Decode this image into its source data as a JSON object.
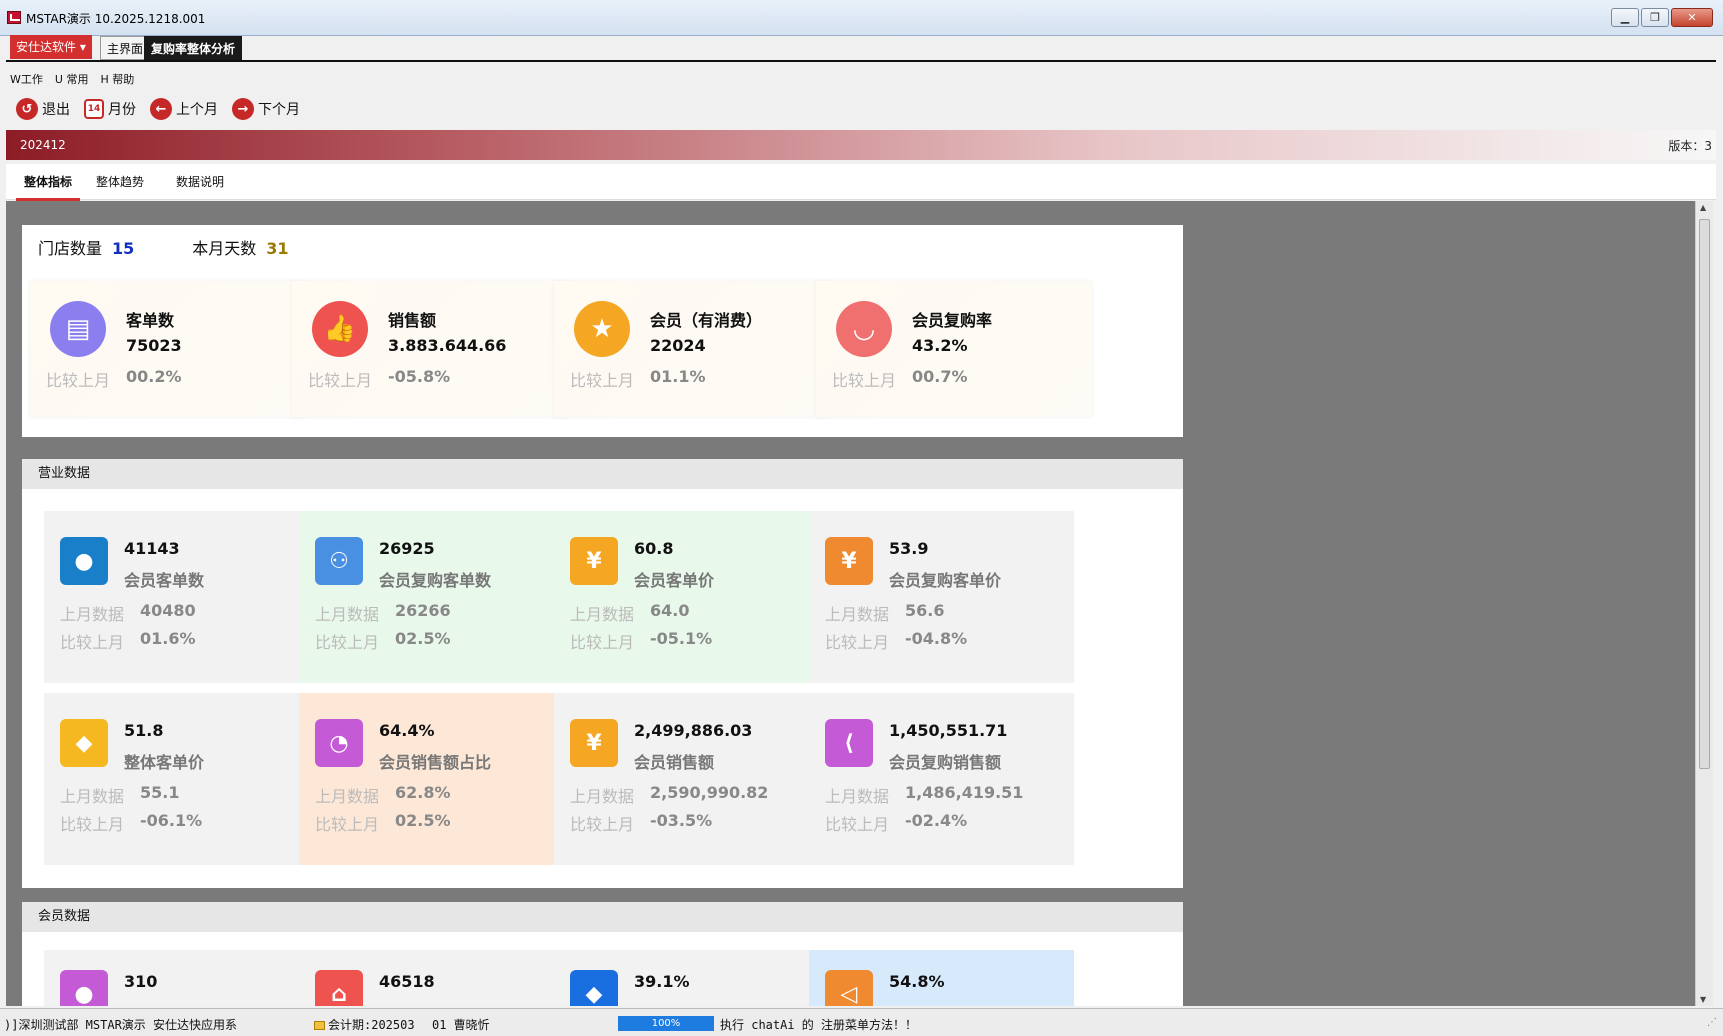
{
  "window": {
    "title": "MSTAR演示   10.2025.1218.001"
  },
  "tabs": {
    "brand": "安仕达软件",
    "main": "主界面",
    "active": "复购率整体分析"
  },
  "menu": [
    "W工作",
    "U 常用",
    "H 帮助"
  ],
  "toolbar": {
    "exit": "退出",
    "month": "月份",
    "calendar_day": "14",
    "prev": "上个月",
    "next": "下个月"
  },
  "banner": {
    "period": "202412",
    "version": "版本：3"
  },
  "subtabs": [
    "整体指标",
    "整体趋势",
    "数据说明"
  ],
  "summary": {
    "store_label": "门店数量",
    "store_count": "15",
    "days_label": "本月天数",
    "days_count": "31"
  },
  "kpis": [
    {
      "title": "客单数",
      "value": "75023",
      "cmp_label": "比较上月",
      "cmp": "00.2%",
      "icon": "document-icon",
      "color": "#8b7ff0"
    },
    {
      "title": "销售额",
      "value": "3.883.644.66",
      "cmp_label": "比较上月",
      "cmp": "-05.8%",
      "icon": "thumbs-up-icon",
      "color": "#ef5350"
    },
    {
      "title": "会员（有消费）",
      "value": "22024",
      "cmp_label": "比较上月",
      "cmp": "01.1%",
      "icon": "star-icon",
      "color": "#f5a623"
    },
    {
      "title": "会员复购率",
      "value": "43.2%",
      "cmp_label": "比较上月",
      "cmp": "00.7%",
      "icon": "bag-icon",
      "color": "#f07070"
    }
  ],
  "business": {
    "header": "营业数据",
    "cards": [
      {
        "value": "41143",
        "name": "会员客单数",
        "prev_label": "上月数据",
        "prev": "40480",
        "cmp_label": "比较上月",
        "cmp": "01.6%",
        "icon": "user-icon",
        "color": "#1a7fc9",
        "bg": "#f2f2f2"
      },
      {
        "value": "26925",
        "name": "会员复购客单数",
        "prev_label": "上月数据",
        "prev": "26266",
        "cmp_label": "比较上月",
        "cmp": "02.5%",
        "icon": "group-icon",
        "color": "#4a90e2",
        "bg": "#e8f8ea"
      },
      {
        "value": "60.8",
        "name": "会员客单价",
        "prev_label": "上月数据",
        "prev": "64.0",
        "cmp_label": "比较上月",
        "cmp": "-05.1%",
        "icon": "yen-coin-icon",
        "color": "#f5a623",
        "bg": "#e8f8ea"
      },
      {
        "value": "53.9",
        "name": "会员复购客单价",
        "prev_label": "上月数据",
        "prev": "56.6",
        "cmp_label": "比较上月",
        "cmp": "-04.8%",
        "icon": "money-bag-icon",
        "color": "#f08a30",
        "bg": "#f2f2f2"
      },
      {
        "value": "51.8",
        "name": "整体客单价",
        "prev_label": "上月数据",
        "prev": "55.1",
        "cmp_label": "比较上月",
        "cmp": "-06.1%",
        "icon": "diamond-tag-icon",
        "color": "#f5b820",
        "bg": "#f2f2f2"
      },
      {
        "value": "64.4%",
        "name": "会员销售额占比",
        "prev_label": "上月数据",
        "prev": "62.8%",
        "cmp_label": "比较上月",
        "cmp": "02.5%",
        "icon": "pie-chart-icon",
        "color": "#c45ad6",
        "bg": "#fde8d8"
      },
      {
        "value": "2,499,886.03",
        "name": "会员销售额",
        "prev_label": "上月数据",
        "prev": "2,590,990.82",
        "cmp_label": "比较上月",
        "cmp": "-03.5%",
        "icon": "yen-coin-icon",
        "color": "#f5a623",
        "bg": "#f2f2f2"
      },
      {
        "value": "1,450,551.71",
        "name": "会员复购销售额",
        "prev_label": "上月数据",
        "prev": "1,486,419.51",
        "cmp_label": "比较上月",
        "cmp": "-02.4%",
        "icon": "share-icon",
        "color": "#c45ad6",
        "bg": "#f2f2f2"
      }
    ]
  },
  "members": {
    "header": "会员数据",
    "cards": [
      {
        "value": "310",
        "icon": "user-icon",
        "color": "#c45ad6",
        "bg": "#f2f2f2"
      },
      {
        "value": "46518",
        "icon": "house-icon",
        "color": "#ef5350",
        "bg": "#f2f2f2"
      },
      {
        "value": "39.1%",
        "icon": "shapes-icon",
        "color": "#1a6fe0",
        "bg": "#f2f2f2"
      },
      {
        "value": "54.8%",
        "icon": "megaphone-icon",
        "color": "#f08a30",
        "bg": "#d6eafc"
      }
    ]
  },
  "status": {
    "org": ")]深圳测试部 MSTAR演示 安仕达快应用系",
    "period": "会计期:202503",
    "user": "01 曹晓忻",
    "progress": "100%",
    "message": "执行 chatAi 的 注册菜单方法！！"
  }
}
